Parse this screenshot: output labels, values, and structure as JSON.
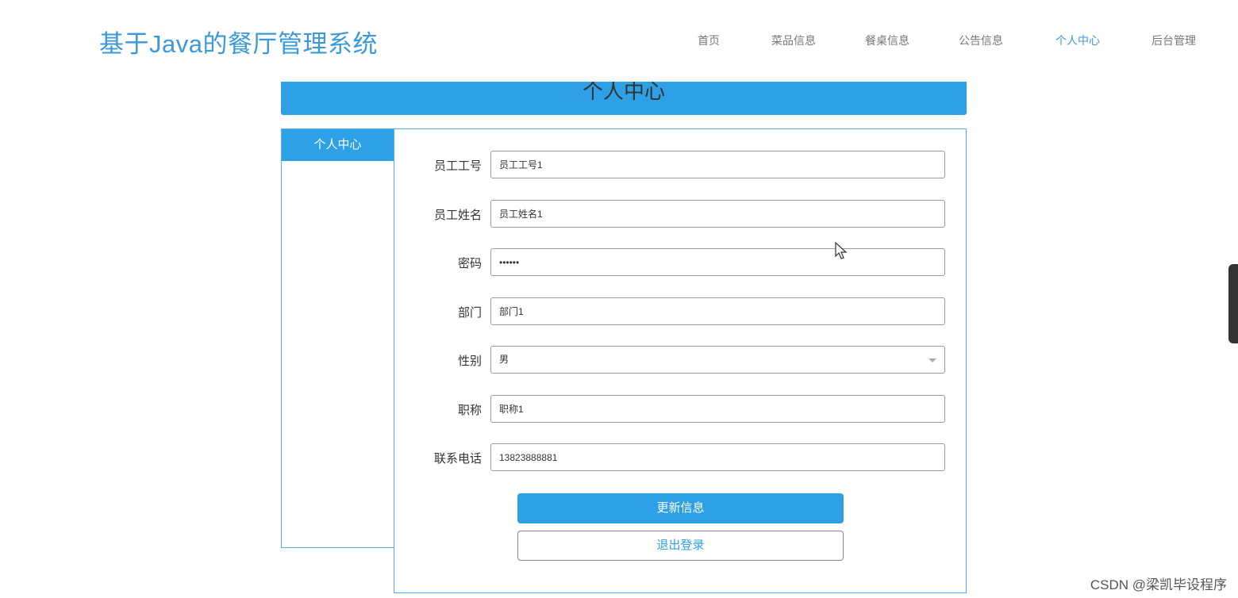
{
  "header": {
    "site_title": "基于Java的餐厅管理系统",
    "nav": [
      {
        "label": "首页"
      },
      {
        "label": "菜品信息"
      },
      {
        "label": "餐桌信息"
      },
      {
        "label": "公告信息"
      },
      {
        "label": "个人中心",
        "active": true
      },
      {
        "label": "后台管理"
      }
    ]
  },
  "banner": {
    "title": "个人中心"
  },
  "sidebar": {
    "items": [
      {
        "label": "个人中心"
      }
    ]
  },
  "form": {
    "fields": [
      {
        "label": "员工工号",
        "value": "员工工号1"
      },
      {
        "label": "员工姓名",
        "value": "员工姓名1"
      },
      {
        "label": "密码",
        "value": "••••••"
      },
      {
        "label": "部门",
        "value": "部门1"
      },
      {
        "label": "性别",
        "value": "男"
      },
      {
        "label": "职称",
        "value": "职称1"
      },
      {
        "label": "联系电话",
        "value": "13823888881"
      }
    ],
    "update_button": "更新信息",
    "logout_button": "退出登录"
  },
  "watermark": "CSDN @梁凯毕设程序",
  "colors": {
    "accent": "#2ea0e6",
    "title": "#3a9ad9"
  },
  "icons": [
    "mouse-cursor-icon",
    "chevron-down-icon"
  ]
}
